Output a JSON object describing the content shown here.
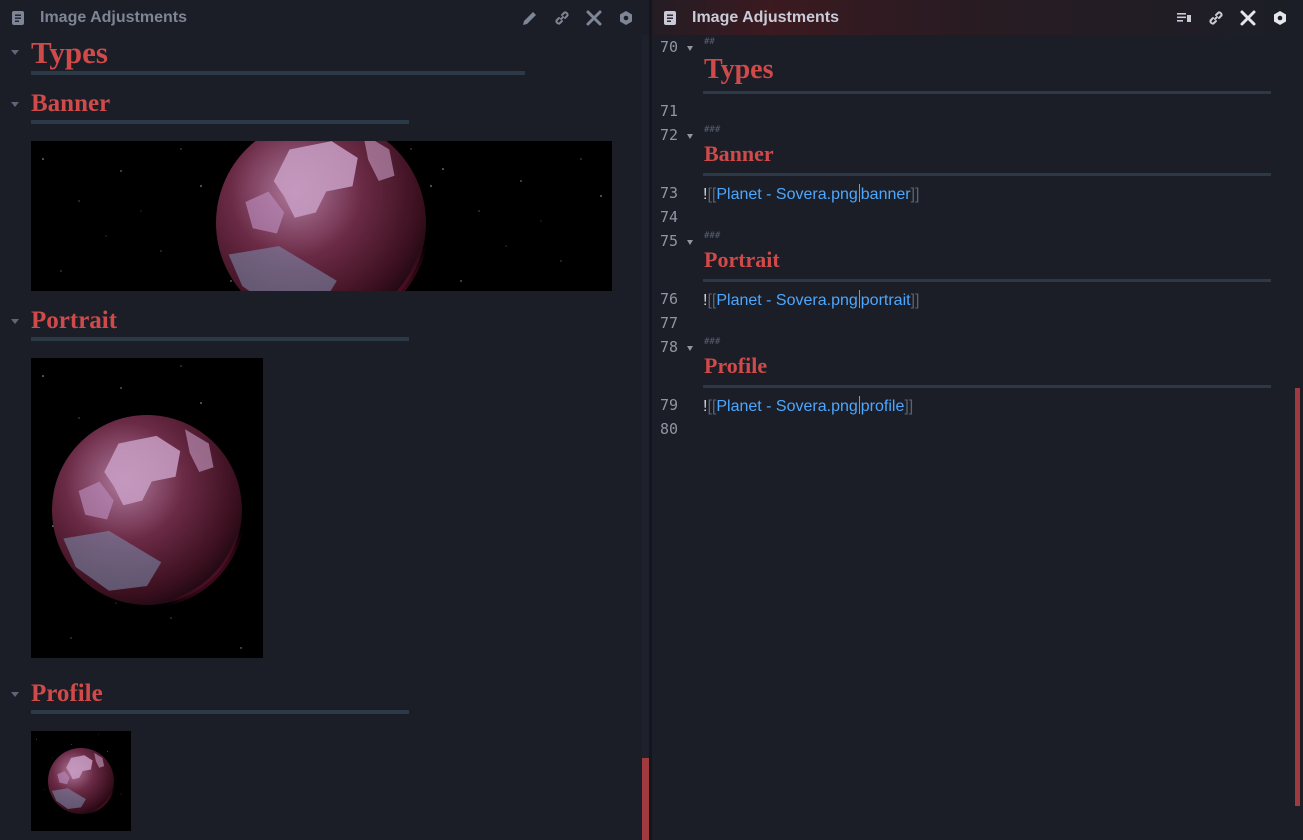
{
  "left_pane": {
    "title": "Image Adjustments",
    "icons": [
      "edit-icon",
      "link-icon",
      "close-icon",
      "settings-icon"
    ]
  },
  "right_pane": {
    "title": "Image Adjustments",
    "icons": [
      "outline-icon",
      "link-icon",
      "close-icon",
      "settings-icon"
    ]
  },
  "preview": {
    "headings": [
      {
        "level": 2,
        "text": "Types"
      },
      {
        "level": 3,
        "text": "Banner"
      },
      {
        "level": 3,
        "text": "Portrait"
      },
      {
        "level": 3,
        "text": "Profile"
      }
    ]
  },
  "editor": {
    "lines": [
      {
        "num": "70",
        "marker": "##",
        "heading": "Types"
      },
      {
        "num": "71"
      },
      {
        "num": "72",
        "marker": "###",
        "heading": "Banner"
      },
      {
        "num": "73",
        "embed": {
          "bang": "!",
          "open": "[[",
          "file": "Planet - Sovera.png",
          "option": "banner",
          "close": "]]"
        }
      },
      {
        "num": "74"
      },
      {
        "num": "75",
        "marker": "###",
        "heading": "Portrait"
      },
      {
        "num": "76",
        "embed": {
          "bang": "!",
          "open": "[[",
          "file": "Planet - Sovera.png",
          "option": "portrait",
          "close": "]]"
        }
      },
      {
        "num": "77"
      },
      {
        "num": "78",
        "marker": "###",
        "heading": "Profile"
      },
      {
        "num": "79",
        "embed": {
          "bang": "!",
          "open": "[[",
          "file": "Planet - Sovera.png",
          "option": "profile",
          "close": "]]"
        }
      },
      {
        "num": "80"
      }
    ]
  },
  "colors": {
    "background": "#1b1e27",
    "heading": "#d04a4a",
    "link": "#4ca7ff",
    "accent": "#a03a3f"
  }
}
